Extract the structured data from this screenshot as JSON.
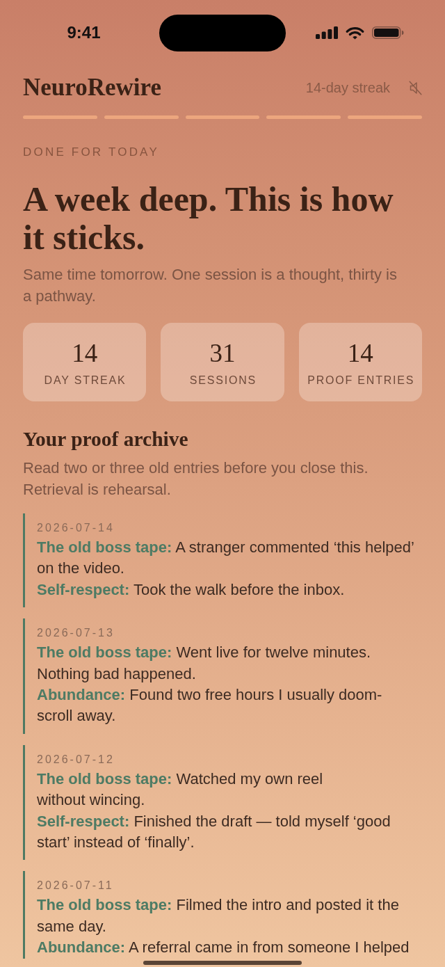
{
  "status_bar": {
    "time": "9:41"
  },
  "header": {
    "app_name": "NeuroRewire",
    "streak": "14-day streak",
    "sound": {
      "muted": true
    },
    "progress": [
      {
        "complete": true
      },
      {
        "complete": true
      },
      {
        "complete": true
      },
      {
        "complete": true
      },
      {
        "complete": true
      }
    ]
  },
  "hero": {
    "eyebrow": "DONE FOR TODAY",
    "title": "A week deep. This is how it sticks.",
    "subtitle": "Same time tomorrow. One session is a thought, thirty is a pathway."
  },
  "stats": [
    {
      "value": "14",
      "label": "DAY STREAK"
    },
    {
      "value": "31",
      "label": "SESSIONS"
    },
    {
      "value": "14",
      "label": "PROOF ENTRIES"
    }
  ],
  "archive": {
    "title": "Your proof archive",
    "subtitle": "Read two or three old entries before you close this. Retrieval is rehearsal.",
    "entries": [
      {
        "date": "2026-07-14",
        "items": [
          {
            "label": "The old boss tape:",
            "text": "A stranger commented ‘this helped’ on the video."
          },
          {
            "label": "Self-respect:",
            "text": "Took the walk before the inbox."
          }
        ]
      },
      {
        "date": "2026-07-13",
        "items": [
          {
            "label": "The old boss tape:",
            "text": "Went live for twelve minutes. Nothing bad happened."
          },
          {
            "label": "Abundance:",
            "text": "Found two free hours I usually doom-scroll away."
          }
        ]
      },
      {
        "date": "2026-07-12",
        "items": [
          {
            "label": "The old boss tape:",
            "text": "Watched my own reel\nwithout wincing."
          },
          {
            "label": "Self-respect:",
            "text": "Finished the draft — told myself ‘good start’ instead of ‘finally’."
          }
        ]
      },
      {
        "date": "2026-07-11",
        "items": [
          {
            "label": "The old boss tape:",
            "text": "Filmed the intro and posted it the same day."
          },
          {
            "label": "Abundance:",
            "text": "A referral came in from someone I helped"
          }
        ]
      }
    ]
  }
}
